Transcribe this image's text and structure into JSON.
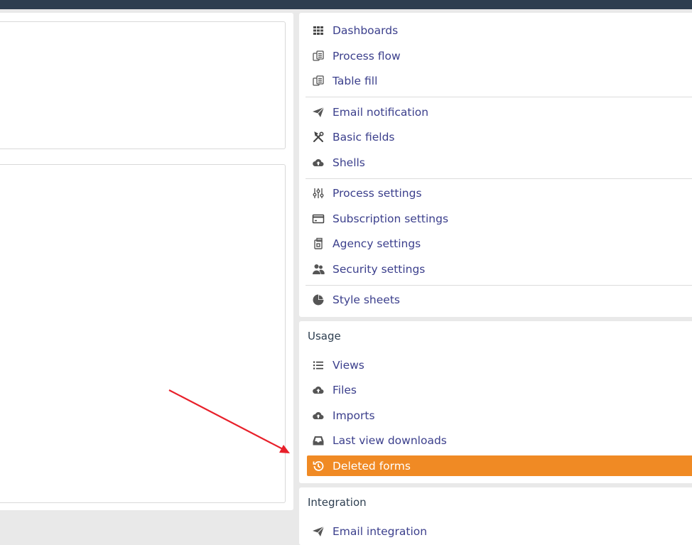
{
  "accent_color": "#f08a24",
  "header_color": "#2d3e50",
  "menu": {
    "dashboards": "Dashboards",
    "process_flow": "Process flow",
    "table_fill": "Table fill",
    "email_notification": "Email notification",
    "basic_fields": "Basic fields",
    "shells": "Shells",
    "process_settings": "Process settings",
    "subscription_settings": "Subscription settings",
    "agency_settings": "Agency settings",
    "security_settings": "Security settings",
    "style_sheets": "Style sheets"
  },
  "usage": {
    "title": "Usage",
    "views": "Views",
    "files": "Files",
    "imports": "Imports",
    "last_view_downloads": "Last view downloads",
    "deleted_forms": "Deleted forms"
  },
  "integration": {
    "title": "Integration",
    "email_integration": "Email integration"
  }
}
